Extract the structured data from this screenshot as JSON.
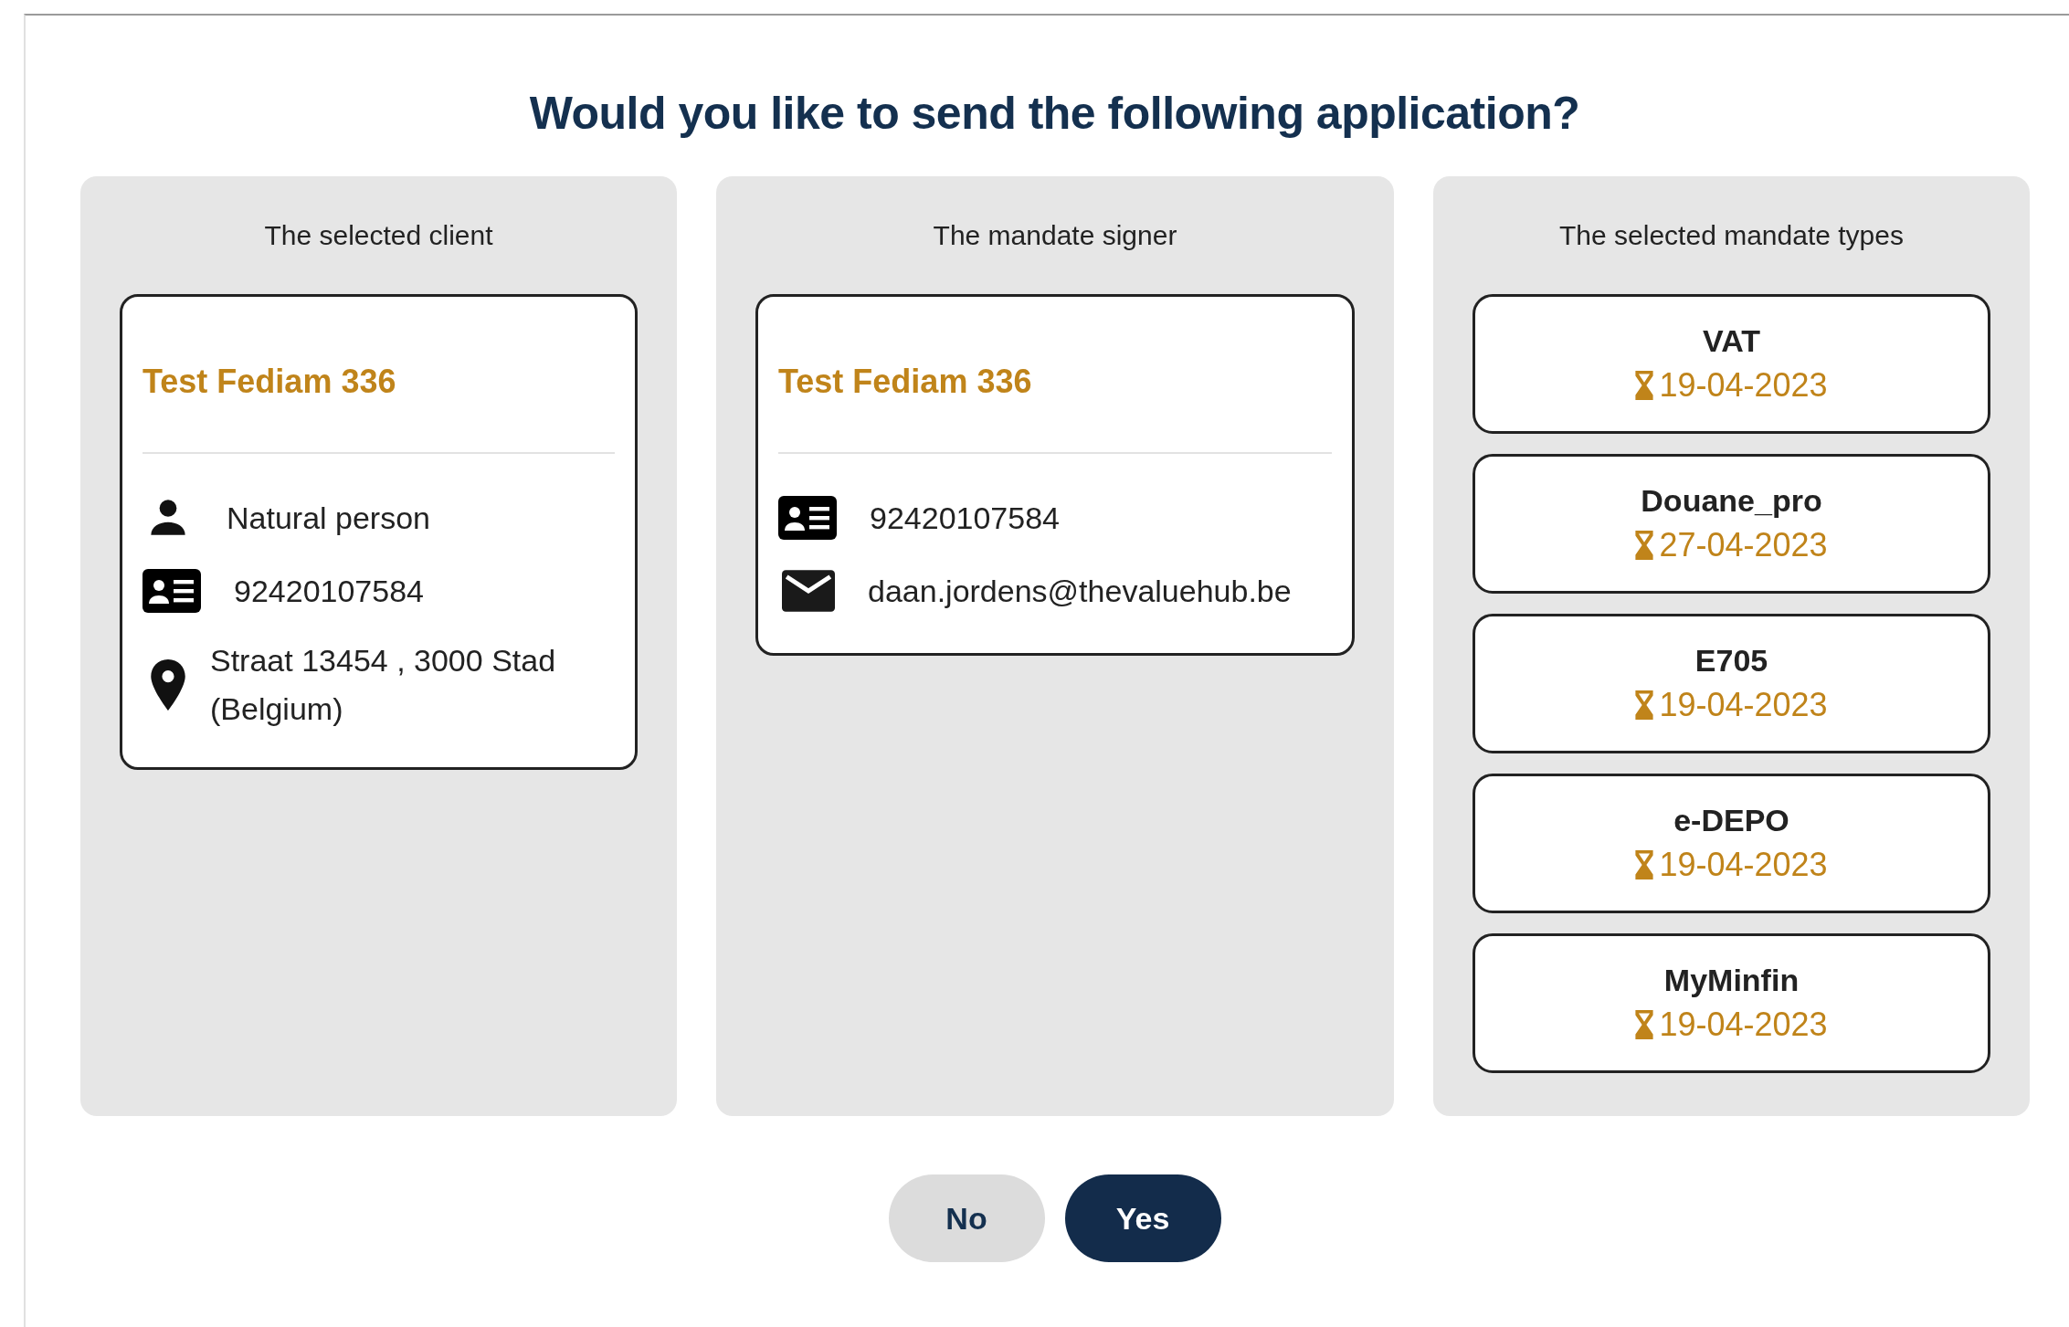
{
  "dialog": {
    "title": "Would you like to send the following application?"
  },
  "panels": [
    {
      "heading": "The selected client",
      "kind": "contact",
      "name": "Test Fediam 336",
      "rows": [
        {
          "kind": "person",
          "text": "Natural person"
        },
        {
          "kind": "id",
          "text": "92420107584"
        },
        {
          "kind": "address",
          "text": "Straat 13454 , 3000 Stad (Belgium)"
        }
      ]
    },
    {
      "heading": "The mandate signer",
      "kind": "contact",
      "name": "Test Fediam 336",
      "rows": [
        {
          "kind": "id",
          "text": "92420107584"
        },
        {
          "kind": "email",
          "text": "daan.jordens@thevaluehub.be"
        }
      ]
    },
    {
      "heading": "The selected mandate types",
      "kind": "mandates",
      "mandates": [
        {
          "name": "VAT",
          "date": "19-04-2023"
        },
        {
          "name": "Douane_pro",
          "date": "27-04-2023"
        },
        {
          "name": "E705",
          "date": "19-04-2023"
        },
        {
          "name": "e-DEPO",
          "date": "19-04-2023"
        },
        {
          "name": "MyMinfin",
          "date": "19-04-2023"
        }
      ]
    }
  ],
  "buttons": [
    {
      "label": "No",
      "kind": "secondary"
    },
    {
      "label": "Yes",
      "kind": "primary"
    }
  ]
}
